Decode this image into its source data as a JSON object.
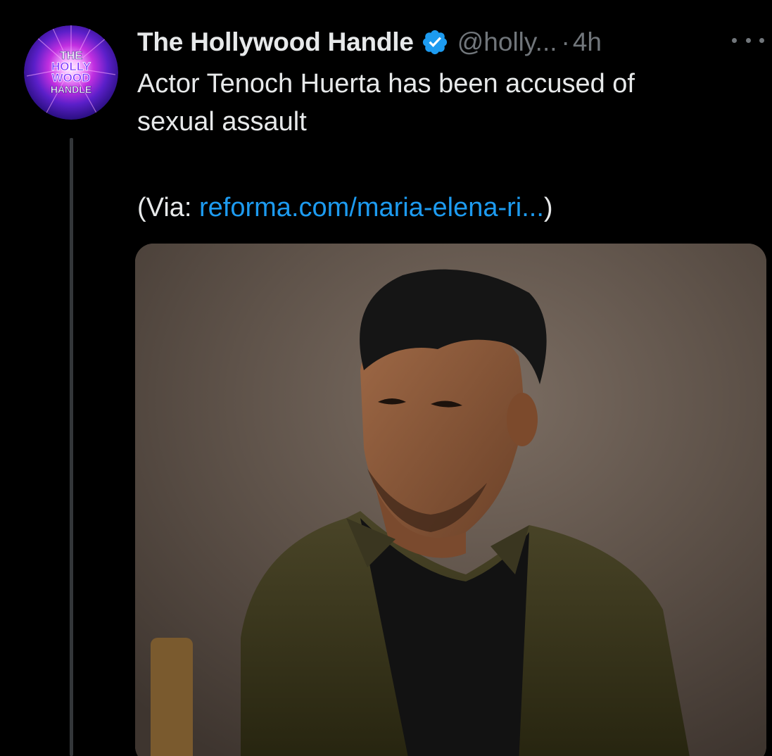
{
  "tweet": {
    "display_name": "The Hollywood Handle",
    "handle": "@holly...",
    "separator": "·",
    "time": "4h",
    "text_line1": "Actor Tenoch Huerta has been accused of",
    "text_line2": "sexual assault",
    "via_prefix": "(Via: ",
    "via_link": "reforma.com/maria-elena-ri...",
    "via_suffix": ")",
    "verified": true,
    "avatar": {
      "line1": "THE",
      "line2": "HOLLY",
      "line3": "WOOD",
      "line4": "HANDLE"
    }
  },
  "icons": {
    "verified": "verified-badge-icon",
    "more": "more-options-icon"
  },
  "colors": {
    "background": "#000000",
    "text": "#e7e9ea",
    "muted": "#71767b",
    "link": "#1d9bf0",
    "verified": "#1d9bf0"
  }
}
